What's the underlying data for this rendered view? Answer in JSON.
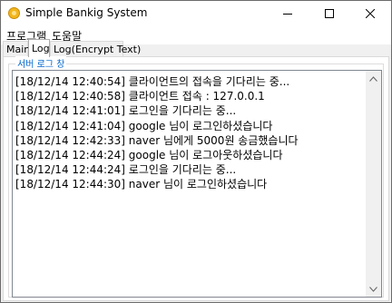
{
  "window": {
    "title": "Simple Bankig System",
    "icon": "coin-icon",
    "controls": [
      "minimize-icon",
      "maximize-icon",
      "close-icon"
    ]
  },
  "menubar": {
    "items": [
      "프로그램",
      "도움말"
    ]
  },
  "tabs": [
    {
      "label": "Main",
      "active": false
    },
    {
      "label": "Log",
      "active": true
    },
    {
      "label": "Log(Encrypt Text)",
      "active": false
    }
  ],
  "log_panel": {
    "group_label": "서버 로그 창",
    "lines": [
      "[18/12/14 12:40:54] 클라이언트의 접속을 기다리는 중...",
      "[18/12/14 12:40:58] 클라이언트 접속 : 127.0.0.1",
      "[18/12/14 12:41:01] 로그인을 기다리는 중...",
      "[18/12/14 12:41:04] google 님이 로그인하셨습니다",
      "[18/12/14 12:42:33] naver 님에게 5000원 송금했습니다",
      "[18/12/14 12:44:24] google 님이 로그아웃하셨습니다",
      "[18/12/14 12:44:24] 로그인을 기다리는 중...",
      "[18/12/14 12:44:30] naver 님이 로그인하셨습니다"
    ]
  },
  "colors": {
    "group_label": "#0066cc",
    "window_bg": "#f0f0f0",
    "titlebar_bg": "#ffffff"
  }
}
